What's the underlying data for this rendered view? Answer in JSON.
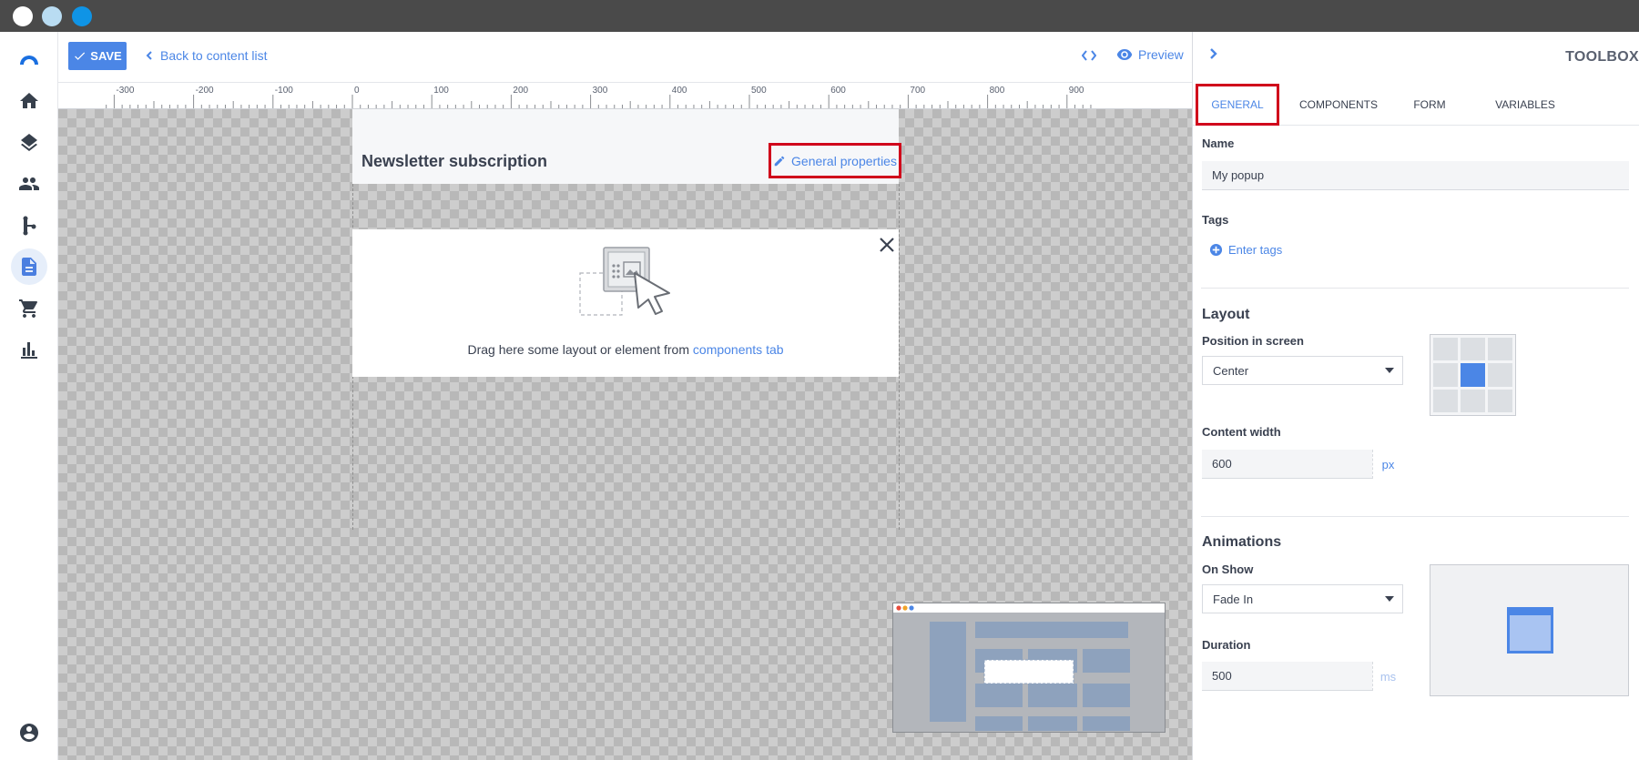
{
  "toolbar": {
    "save_label": "SAVE",
    "back_label": "Back to content list",
    "preview_label": "Preview"
  },
  "ruler": {
    "labels": [
      "-300",
      "-200",
      "-100",
      "0",
      "100",
      "200",
      "300",
      "400",
      "500",
      "600",
      "700",
      "800",
      "900"
    ]
  },
  "canvas": {
    "popup_title": "Newsletter subscription",
    "general_properties_label": "General properties",
    "drop_text": "Drag here some layout or element from ",
    "drop_link": "components tab"
  },
  "toolbox": {
    "title": "TOOLBOX",
    "tabs": [
      {
        "label": "GENERAL",
        "active": true
      },
      {
        "label": "COMPONENTS",
        "active": false
      },
      {
        "label": "FORM",
        "active": false
      },
      {
        "label": "VARIABLES",
        "active": false
      }
    ],
    "name_label": "Name",
    "name_value": "My popup",
    "tags_label": "Tags",
    "tags_placeholder": "Enter tags",
    "layout": {
      "title": "Layout",
      "position_label": "Position in screen",
      "position_value": "Center",
      "content_width_label": "Content width",
      "content_width_value": "600",
      "content_width_unit": "px",
      "position_selected": "center"
    },
    "animations": {
      "title": "Animations",
      "on_show_label": "On Show",
      "on_show_value": "Fade In",
      "duration_label": "Duration",
      "duration_value": "500",
      "duration_unit": "ms"
    }
  },
  "nav": {
    "items": [
      "logo-icon",
      "home-icon",
      "layers-icon",
      "people-icon",
      "flow-icon",
      "document-icon",
      "cart-icon",
      "chart-icon",
      "account-icon"
    ],
    "active": "document-icon"
  },
  "colors": {
    "accent": "#4b86e6",
    "highlight": "#d0021b",
    "titlebar": "#4a4a4a"
  }
}
